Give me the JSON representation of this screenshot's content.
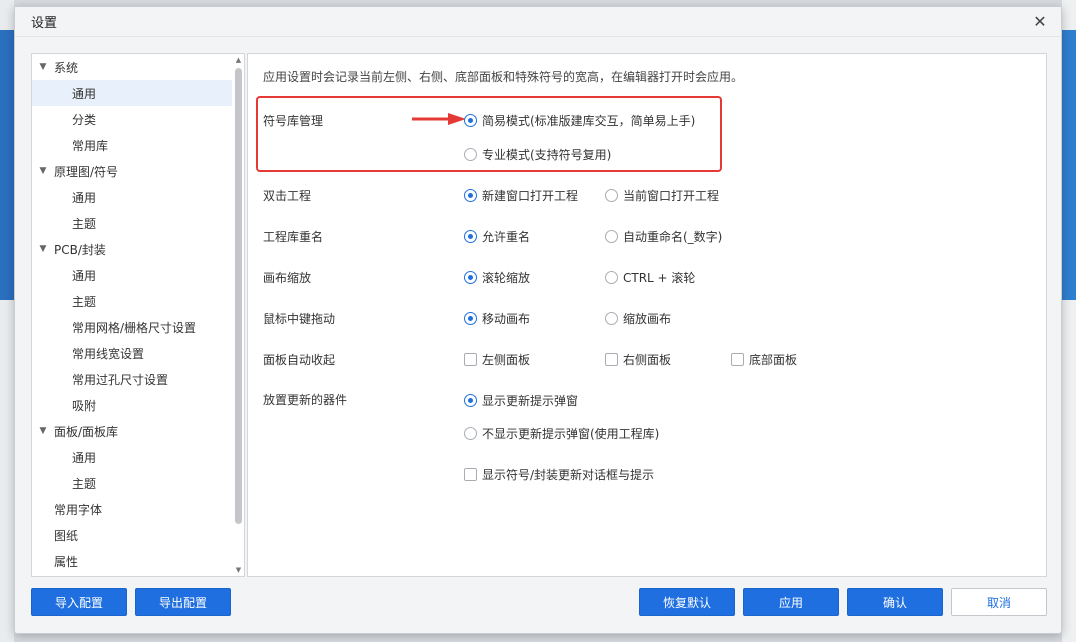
{
  "dialog": {
    "title": "设置",
    "close_icon": "close-icon"
  },
  "sidebar": {
    "groups": [
      {
        "label": "系统",
        "children": [
          "通用",
          "分类",
          "常用库"
        ]
      },
      {
        "label": "原理图/符号",
        "children": [
          "通用",
          "主题"
        ]
      },
      {
        "label": "PCB/封装",
        "children": [
          "通用",
          "主题",
          "常用网格/栅格尺寸设置",
          "常用线宽设置",
          "常用过孔尺寸设置",
          "吸附"
        ]
      },
      {
        "label": "面板/面板库",
        "children": [
          "通用",
          "主题"
        ]
      }
    ],
    "leaves": [
      "常用字体",
      "图纸",
      "属性"
    ],
    "selected": "系统 > 通用"
  },
  "content": {
    "description": "应用设置时会记录当前左侧、右侧、底部面板和特殊符号的宽高，在编辑器打开时会应用。",
    "rows": {
      "symbol_lib": {
        "label": "符号库管理",
        "options": [
          "简易模式(标准版建库交互，简单易上手)",
          "专业模式(支持符号复用)"
        ],
        "selected": 0
      },
      "double_click": {
        "label": "双击工程",
        "options": [
          "新建窗口打开工程",
          "当前窗口打开工程"
        ],
        "selected": 0
      },
      "rename": {
        "label": "工程库重名",
        "options": [
          "允许重名",
          "自动重命名(_数字)"
        ],
        "selected": 0
      },
      "zoom": {
        "label": "画布缩放",
        "options": [
          "滚轮缩放",
          "CTRL + 滚轮"
        ],
        "selected": 0
      },
      "middle_drag": {
        "label": "鼠标中键拖动",
        "options": [
          "移动画布",
          "缩放画布"
        ],
        "selected": 0
      },
      "auto_collapse": {
        "label": "面板自动收起",
        "options": [
          "左侧面板",
          "右侧面板",
          "底部面板"
        ],
        "checked": [
          false,
          false,
          false
        ]
      },
      "update_parts": {
        "label": "放置更新的器件",
        "options": [
          "显示更新提示弹窗",
          "不显示更新提示弹窗(使用工程库)"
        ],
        "selected": 0,
        "checkbox_label": "显示符号/封装更新对话框与提示",
        "checkbox_checked": false
      }
    }
  },
  "footer": {
    "import": "导入配置",
    "export": "导出配置",
    "restore": "恢复默认",
    "apply": "应用",
    "ok": "确认",
    "cancel": "取消"
  },
  "colors": {
    "accent": "#1f6fe0",
    "highlight": "#e53935"
  }
}
